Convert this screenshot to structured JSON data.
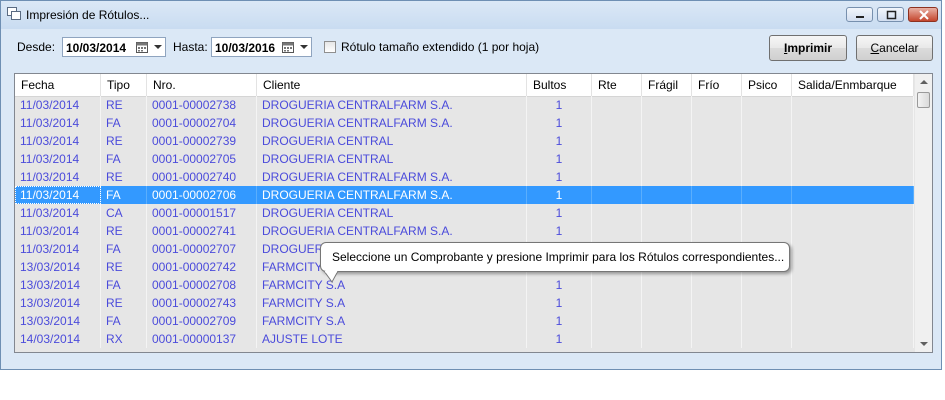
{
  "window": {
    "title": "Impresión de Rótulos...",
    "minimize_glyph": "min",
    "maximize_glyph": "max",
    "close_glyph": "close"
  },
  "filters": {
    "desde_label": "Desde:",
    "desde_value": "10/03/2014",
    "hasta_label": "Hasta:",
    "hasta_value": "10/03/2016",
    "extended_label": "Rótulo tamaño extendido (1 por hoja)",
    "extended_checked": false
  },
  "buttons": {
    "print_label": "Imprimir",
    "cancel_label": "Cancelar"
  },
  "grid": {
    "columns": [
      "Fecha",
      "Tipo",
      "Nro.",
      "Cliente",
      "Bultos",
      "Rte",
      "Frágil",
      "Frío",
      "Psico",
      "Salida/Enmbarque"
    ],
    "selected_index": 5,
    "rows": [
      {
        "fecha": "11/03/2014",
        "tipo": "RE",
        "nro": "0001-00002738",
        "cliente": "DROGUERIA CENTRALFARM  S.A.",
        "bultos": "1"
      },
      {
        "fecha": "11/03/2014",
        "tipo": "FA",
        "nro": "0001-00002704",
        "cliente": "DROGUERIA CENTRALFARM  S.A.",
        "bultos": "1"
      },
      {
        "fecha": "11/03/2014",
        "tipo": "RE",
        "nro": "0001-00002739",
        "cliente": "DROGUERIA CENTRAL",
        "bultos": "1"
      },
      {
        "fecha": "11/03/2014",
        "tipo": "FA",
        "nro": "0001-00002705",
        "cliente": "DROGUERIA CENTRAL",
        "bultos": "1"
      },
      {
        "fecha": "11/03/2014",
        "tipo": "RE",
        "nro": "0001-00002740",
        "cliente": "DROGUERIA CENTRALFARM  S.A.",
        "bultos": "1"
      },
      {
        "fecha": "11/03/2014",
        "tipo": "FA",
        "nro": "0001-00002706",
        "cliente": "DROGUERIA CENTRALFARM  S.A.",
        "bultos": "1"
      },
      {
        "fecha": "11/03/2014",
        "tipo": "CA",
        "nro": "0001-00001517",
        "cliente": "DROGUERIA CENTRAL",
        "bultos": "1"
      },
      {
        "fecha": "11/03/2014",
        "tipo": "RE",
        "nro": "0001-00002741",
        "cliente": "DROGUERIA CENTRALFARM  S.A.",
        "bultos": "1"
      },
      {
        "fecha": "11/03/2014",
        "tipo": "FA",
        "nro": "0001-00002707",
        "cliente": "DROGUERI",
        "bultos": ""
      },
      {
        "fecha": "13/03/2014",
        "tipo": "RE",
        "nro": "0001-00002742",
        "cliente": "FARMCITY",
        "bultos": ""
      },
      {
        "fecha": "13/03/2014",
        "tipo": "FA",
        "nro": "0001-00002708",
        "cliente": "FARMCITY S.A",
        "bultos": "1"
      },
      {
        "fecha": "13/03/2014",
        "tipo": "RE",
        "nro": "0001-00002743",
        "cliente": "FARMCITY S.A",
        "bultos": "1"
      },
      {
        "fecha": "13/03/2014",
        "tipo": "FA",
        "nro": "0001-00002709",
        "cliente": "FARMCITY S.A",
        "bultos": "1"
      },
      {
        "fecha": "14/03/2014",
        "tipo": "RX",
        "nro": "0001-00000137",
        "cliente": "AJUSTE LOTE",
        "bultos": "1"
      }
    ]
  },
  "tooltip": {
    "text": "Seleccione un Comprobante y presione Imprimir para los Rótulos correspondientes..."
  },
  "colors": {
    "row_text": "#4b4bdb",
    "selection": "#3399ff",
    "grid_bg": "#e6e6e6",
    "window_bg": "#dbe8f6"
  }
}
